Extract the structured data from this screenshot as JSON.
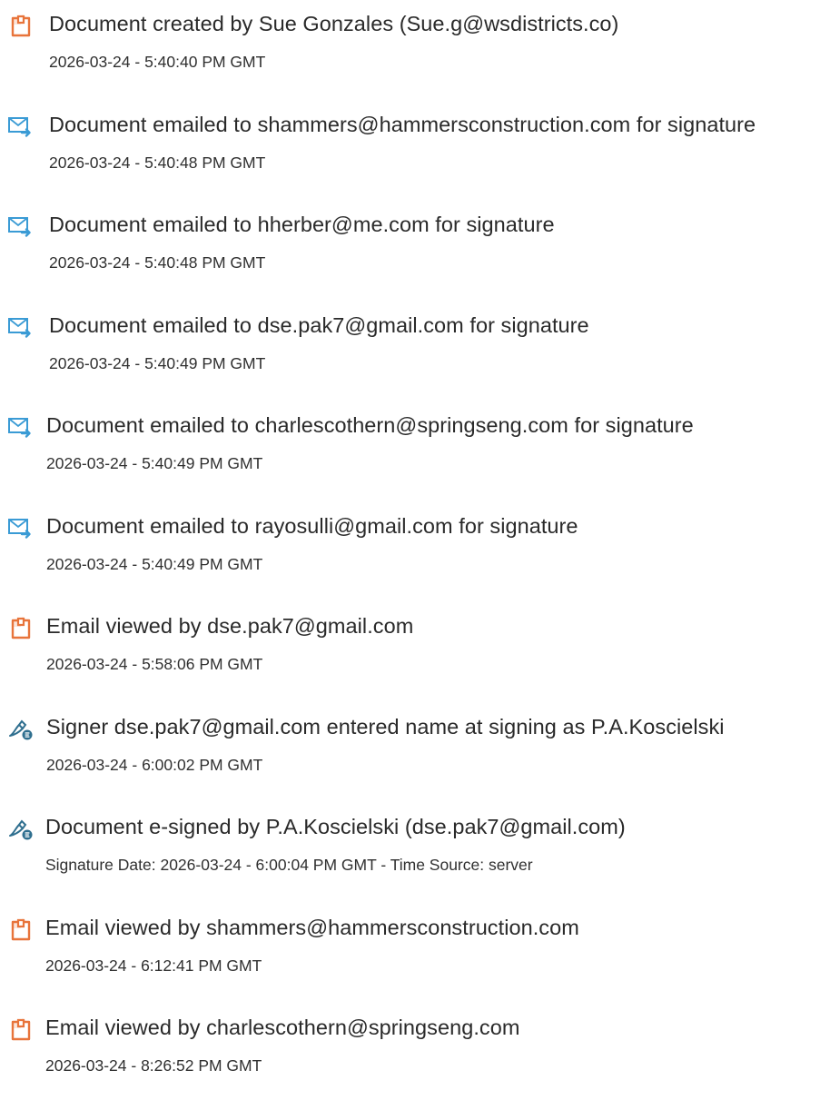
{
  "colors": {
    "doc_icon": "#e8743b",
    "email_icon": "#3a9bd5",
    "sign_icon": "#2f6f8f",
    "text": "#2a2a2a"
  },
  "events": [
    {
      "icon": "document-icon",
      "title": "Document created by Sue Gonzales (Sue.g@wsdistricts.co)",
      "meta": "2026-03-24 - 5:40:40 PM GMT"
    },
    {
      "icon": "email-sent-icon",
      "title": "Document emailed to shammers@hammersconstruction.com for signature",
      "meta": "2026-03-24 - 5:40:48 PM GMT"
    },
    {
      "icon": "email-sent-icon",
      "title": "Document emailed to hherber@me.com for signature",
      "meta": "2026-03-24 - 5:40:48 PM GMT"
    },
    {
      "icon": "email-sent-icon",
      "title": "Document emailed to dse.pak7@gmail.com for signature",
      "meta": "2026-03-24 - 5:40:49 PM GMT"
    },
    {
      "icon": "email-sent-icon",
      "title": "Document emailed to charlescothern@springseng.com for signature",
      "meta": "2026-03-24 - 5:40:49 PM GMT"
    },
    {
      "icon": "email-sent-icon",
      "title": "Document emailed to rayosulli@gmail.com for signature",
      "meta": "2026-03-24 - 5:40:49 PM GMT"
    },
    {
      "icon": "document-icon",
      "title": "Email viewed by dse.pak7@gmail.com",
      "meta": "2026-03-24 - 5:58:06 PM GMT"
    },
    {
      "icon": "esign-pen-icon",
      "title": "Signer dse.pak7@gmail.com entered name at signing as P.A.Koscielski",
      "meta": "2026-03-24 - 6:00:02 PM GMT"
    },
    {
      "icon": "esign-pen-icon",
      "title": "Document e-signed by P.A.Koscielski (dse.pak7@gmail.com)",
      "meta": "Signature Date: 2026-03-24 - 6:00:04 PM GMT - Time Source: server"
    },
    {
      "icon": "document-icon",
      "title": "Email viewed by shammers@hammersconstruction.com",
      "meta": "2026-03-24 - 6:12:41 PM GMT"
    },
    {
      "icon": "document-icon",
      "title": "Email viewed by charlescothern@springseng.com",
      "meta": "2026-03-24 - 8:26:52 PM GMT"
    }
  ]
}
